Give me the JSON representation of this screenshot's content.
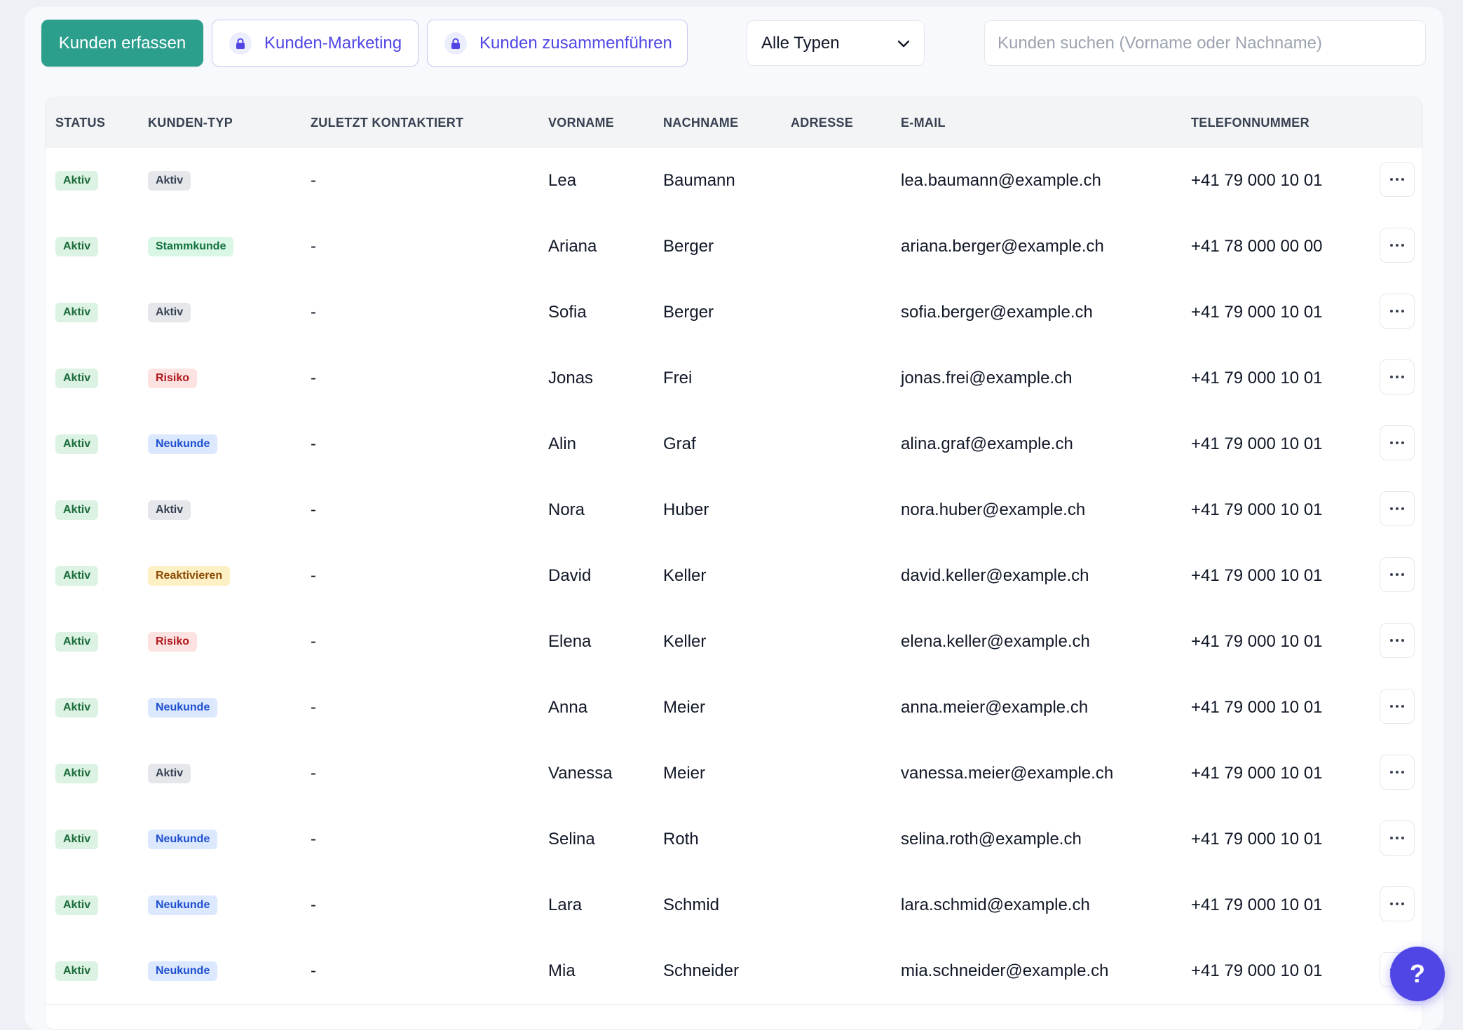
{
  "toolbar": {
    "create_label": "Kunden erfassen",
    "marketing_label": "Kunden-Marketing",
    "merge_label": "Kunden zusammenführen",
    "type_filter": "Alle Typen",
    "search_placeholder": "Kunden suchen (Vorname oder Nachname)"
  },
  "table": {
    "headers": {
      "status": "STATUS",
      "type": "KUNDEN-TYP",
      "last_contact": "ZULETZT KONTAKTIERT",
      "first": "VORNAME",
      "last": "NACHNAME",
      "address": "ADRESSE",
      "email": "E-MAIL",
      "phone": "TELEFONNUMMER"
    },
    "rows": [
      {
        "status": "Aktiv",
        "type": "Aktiv",
        "last_contact": "-",
        "first": "Lea",
        "last": "Baumann",
        "address": "",
        "email": "lea.baumann@example.ch",
        "phone": "+41 79 000 10 01"
      },
      {
        "status": "Aktiv",
        "type": "Stammkunde",
        "last_contact": "-",
        "first": "Ariana",
        "last": "Berger",
        "address": "",
        "email": "ariana.berger@example.ch",
        "phone": "+41 78 000 00 00"
      },
      {
        "status": "Aktiv",
        "type": "Aktiv",
        "last_contact": "-",
        "first": "Sofia",
        "last": "Berger",
        "address": "",
        "email": "sofia.berger@example.ch",
        "phone": "+41 79 000 10 01"
      },
      {
        "status": "Aktiv",
        "type": "Risiko",
        "last_contact": "-",
        "first": "Jonas",
        "last": "Frei",
        "address": "",
        "email": "jonas.frei@example.ch",
        "phone": "+41 79 000 10 01"
      },
      {
        "status": "Aktiv",
        "type": "Neukunde",
        "last_contact": "-",
        "first": "Alin",
        "last": "Graf",
        "address": "",
        "email": "alina.graf@example.ch",
        "phone": "+41 79 000 10 01"
      },
      {
        "status": "Aktiv",
        "type": "Aktiv",
        "last_contact": "-",
        "first": "Nora",
        "last": "Huber",
        "address": "",
        "email": "nora.huber@example.ch",
        "phone": "+41 79 000 10 01"
      },
      {
        "status": "Aktiv",
        "type": "Reaktivieren",
        "last_contact": "-",
        "first": "David",
        "last": "Keller",
        "address": "",
        "email": "david.keller@example.ch",
        "phone": "+41 79 000 10 01"
      },
      {
        "status": "Aktiv",
        "type": "Risiko",
        "last_contact": "-",
        "first": "Elena",
        "last": "Keller",
        "address": "",
        "email": "elena.keller@example.ch",
        "phone": "+41 79 000 10 01"
      },
      {
        "status": "Aktiv",
        "type": "Neukunde",
        "last_contact": "-",
        "first": "Anna",
        "last": "Meier",
        "address": "",
        "email": "anna.meier@example.ch",
        "phone": "+41 79 000 10 01"
      },
      {
        "status": "Aktiv",
        "type": "Aktiv",
        "last_contact": "-",
        "first": "Vanessa",
        "last": "Meier",
        "address": "",
        "email": "vanessa.meier@example.ch",
        "phone": "+41 79 000 10 01"
      },
      {
        "status": "Aktiv",
        "type": "Neukunde",
        "last_contact": "-",
        "first": "Selina",
        "last": "Roth",
        "address": "",
        "email": "selina.roth@example.ch",
        "phone": "+41 79 000 10 01"
      },
      {
        "status": "Aktiv",
        "type": "Neukunde",
        "last_contact": "-",
        "first": "Lara",
        "last": "Schmid",
        "address": "",
        "email": "lara.schmid@example.ch",
        "phone": "+41 79 000 10 01"
      },
      {
        "status": "Aktiv",
        "type": "Neukunde",
        "last_contact": "-",
        "first": "Mia",
        "last": "Schneider",
        "address": "",
        "email": "mia.schneider@example.ch",
        "phone": "+41 79 000 10 01"
      }
    ]
  },
  "help_label": "?",
  "icons": {
    "lock": "lock-icon",
    "chevron": "chevron-down-icon",
    "more": "more-horizontal-icon"
  },
  "colors": {
    "primary": "#2b9e8c",
    "accent": "#4f46e5"
  }
}
